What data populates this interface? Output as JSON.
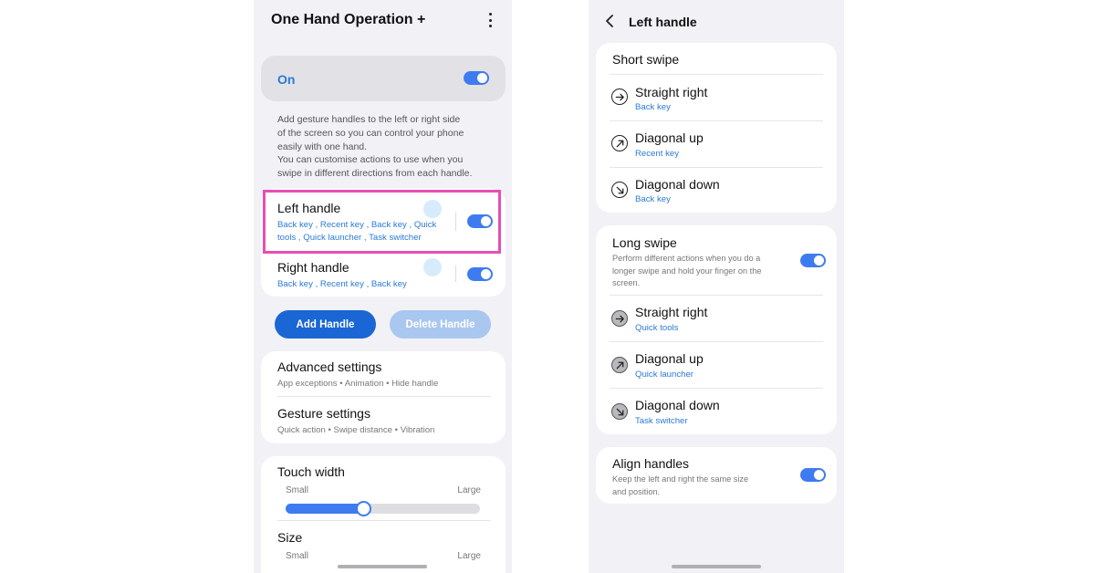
{
  "left_screen": {
    "title": "One Hand Operation +",
    "master_toggle": {
      "label": "On",
      "on": true
    },
    "description_lines": [
      "Add gesture handles to the left or right side",
      "of the screen so you can control your phone",
      "easily with one hand.",
      "You can customise actions to use when you",
      "swipe in different directions from each handle."
    ],
    "handles": [
      {
        "title": "Left handle",
        "actions_lines": [
          "Back key , Recent key , Back key , Quick",
          "tools , Quick launcher , Task switcher"
        ],
        "on": true
      },
      {
        "title": "Right handle",
        "actions_lines": [
          "Back key , Recent key , Back key"
        ],
        "on": true
      }
    ],
    "buttons": {
      "add": "Add Handle",
      "delete": "Delete Handle"
    },
    "settings": [
      {
        "title": "Advanced settings",
        "subtitle": "App exceptions • Animation • Hide handle"
      },
      {
        "title": "Gesture settings",
        "subtitle": "Quick action • Swipe distance • Vibration"
      }
    ],
    "touch_width": {
      "title": "Touch width",
      "min_label": "Small",
      "max_label": "Large",
      "value_fraction": 0.4
    },
    "size": {
      "title": "Size",
      "min_label": "Small",
      "max_label": "Large"
    }
  },
  "right_screen": {
    "title": "Left handle",
    "short_swipe": {
      "title": "Short swipe",
      "items": [
        {
          "direction": "Straight right",
          "action": "Back key",
          "icon": "arrow-right-icon"
        },
        {
          "direction": "Diagonal up",
          "action": "Recent key",
          "icon": "arrow-up-right-icon"
        },
        {
          "direction": "Diagonal down",
          "action": "Back key",
          "icon": "arrow-down-right-icon"
        }
      ]
    },
    "long_swipe": {
      "title": "Long swipe",
      "description_lines": [
        "Perform different actions when you do a",
        "longer swipe and hold your finger on the",
        "screen."
      ],
      "on": true,
      "items": [
        {
          "direction": "Straight right",
          "action": "Quick tools",
          "icon": "arrow-right-icon"
        },
        {
          "direction": "Diagonal up",
          "action": "Quick launcher",
          "icon": "arrow-up-right-icon"
        },
        {
          "direction": "Diagonal down",
          "action": "Task switcher",
          "icon": "arrow-down-right-icon"
        }
      ]
    },
    "align_handles": {
      "title": "Align handles",
      "description_lines": [
        "Keep the left and right the same size",
        "and position."
      ],
      "on": true
    }
  },
  "colors": {
    "accent": "#3e7bf0",
    "link": "#2c7ad6",
    "highlight": "#e64fb4",
    "background": "#f2f1f6"
  }
}
